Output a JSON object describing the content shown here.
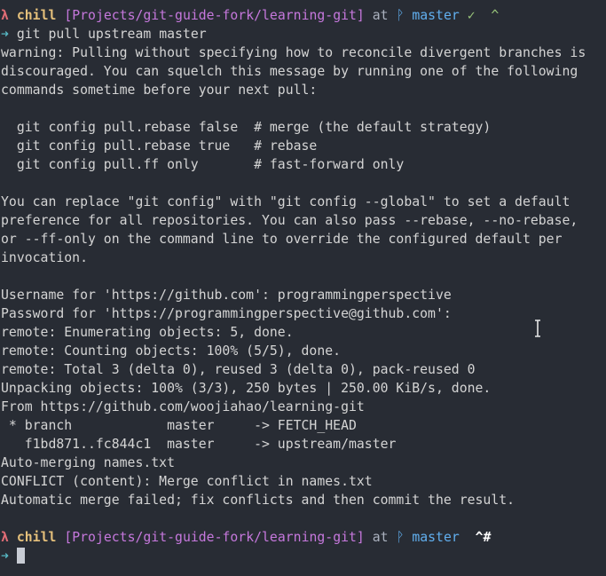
{
  "prompt": {
    "symbol": "λ",
    "user": "chill",
    "path": "[Projects/git-guide-fork/learning-git]",
    "at": "at",
    "branch_glyph": "ᚹ",
    "branch": "master",
    "status_first": "✓  ^",
    "status_second": " ^#",
    "arrow": "➜"
  },
  "command": "git pull upstream master",
  "output_lines": [
    "warning: Pulling without specifying how to reconcile divergent branches is",
    "discouraged. You can squelch this message by running one of the following",
    "commands sometime before your next pull:",
    "",
    "  git config pull.rebase false  # merge (the default strategy)",
    "  git config pull.rebase true   # rebase",
    "  git config pull.ff only       # fast-forward only",
    "",
    "You can replace \"git config\" with \"git config --global\" to set a default",
    "preference for all repositories. You can also pass --rebase, --no-rebase,",
    "or --ff-only on the command line to override the configured default per",
    "invocation.",
    "",
    "Username for 'https://github.com': programmingperspective",
    "Password for 'https://programmingperspective@github.com':",
    "remote: Enumerating objects: 5, done.",
    "remote: Counting objects: 100% (5/5), done.",
    "remote: Total 3 (delta 0), reused 3 (delta 0), pack-reused 0",
    "Unpacking objects: 100% (3/3), 250 bytes | 250.00 KiB/s, done.",
    "From https://github.com/woojiahao/learning-git",
    " * branch            master     -> FETCH_HEAD",
    "   f1bd871..fc844c1  master     -> upstream/master",
    "Auto-merging names.txt",
    "CONFLICT (content): Merge conflict in names.txt",
    "Automatic merge failed; fix conflicts and then commit the result.",
    ""
  ],
  "colors": {
    "background": "#282c34",
    "lambda": "#e06c75",
    "user": "#e5c07b",
    "path": "#c678dd",
    "branch": "#61afef",
    "ok": "#98c379",
    "arrow": "#56b6c2"
  },
  "icons": {
    "mouse_cursor": "text-cursor-icon"
  }
}
